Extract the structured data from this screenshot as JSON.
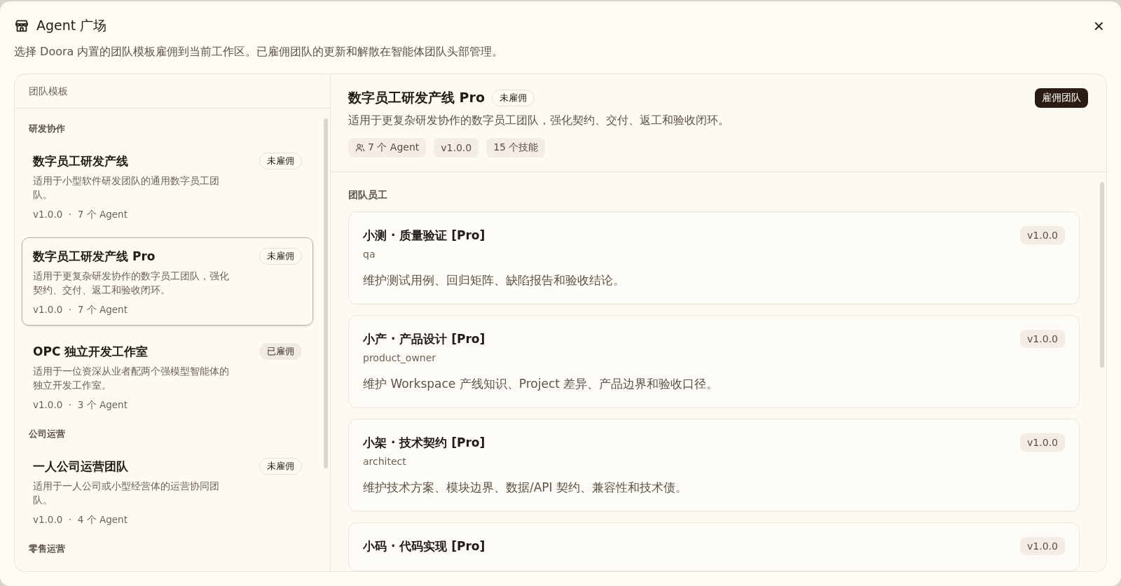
{
  "dialog": {
    "title": "Agent 广场",
    "description": "选择 Doora 内置的团队模板雇佣到当前工作区。已雇佣团队的更新和解散在智能体团队头部管理。",
    "close": "×"
  },
  "sidebar": {
    "header": "团队模板",
    "groups": [
      {
        "label": "研发协作",
        "items": [
          {
            "name": "数字员工研发产线",
            "description": "适用于小型软件研发团队的通用数字员工团队。",
            "meta": "v1.0.0  ·  7 个 Agent",
            "status": "未雇佣",
            "hired": false,
            "selected": false
          },
          {
            "name": "数字员工研发产线 Pro",
            "description": "适用于更复杂研发协作的数字员工团队，强化契约、交付、返工和验收闭环。",
            "meta": "v1.0.0  ·  7 个 Agent",
            "status": "未雇佣",
            "hired": false,
            "selected": true
          },
          {
            "name": "OPC 独立开发工作室",
            "description": "适用于一位资深从业者配两个强模型智能体的独立开发工作室。",
            "meta": "v1.0.0  ·  3 个 Agent",
            "status": "已雇佣",
            "hired": true,
            "selected": false
          }
        ]
      },
      {
        "label": "公司运营",
        "items": [
          {
            "name": "一人公司运营团队",
            "description": "适用于一人公司或小型经营体的运营协同团队。",
            "meta": "v1.0.0  ·  4 个 Agent",
            "status": "未雇佣",
            "hired": false,
            "selected": false
          }
        ]
      },
      {
        "label": "零售运营"
      }
    ]
  },
  "detail": {
    "title": "数字员工研发产线 Pro",
    "status": "未雇佣",
    "hired": false,
    "description": "适用于更复杂研发协作的数字员工团队，强化契约、交付、返工和验收闭环。",
    "hire_button": "雇佣团队",
    "tags": [
      {
        "kind": "agents",
        "label": "7 个 Agent"
      },
      {
        "kind": "plain",
        "label": "v1.0.0"
      },
      {
        "kind": "plain",
        "label": "15 个技能"
      }
    ],
    "members_heading": "团队员工",
    "members": [
      {
        "name": "小测 · 质量验证 [Pro]",
        "role": "qa",
        "description": "维护测试用例、回归矩阵、缺陷报告和验收结论。",
        "version": "v1.0.0"
      },
      {
        "name": "小产 · 产品设计 [Pro]",
        "role": "product_owner",
        "description": "维护 Workspace 产线知识、Project 差异、产品边界和验收口径。",
        "version": "v1.0.0"
      },
      {
        "name": "小架 · 技术契约 [Pro]",
        "role": "architect",
        "description": "维护技术方案、模块边界、数据/API 契约、兼容性和技术债。",
        "version": "v1.0.0"
      },
      {
        "name": "小码 · 代码实现 [Pro]",
        "version": "v1.0.0"
      }
    ]
  }
}
